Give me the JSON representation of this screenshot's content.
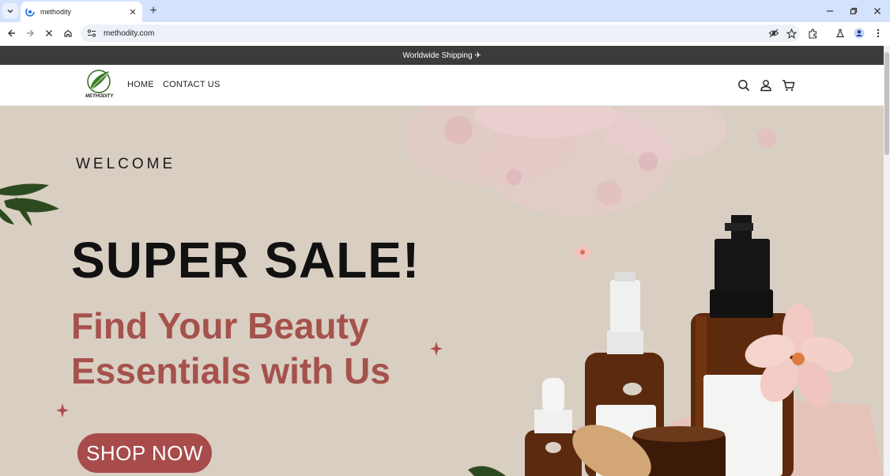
{
  "browser": {
    "tab_title": "methodity",
    "url": "methodity.com"
  },
  "site": {
    "announcement": "Worldwide Shipping ✈",
    "logo_text": "METHODITY",
    "nav": [
      {
        "label": "HOME"
      },
      {
        "label": "CONTACT US"
      }
    ]
  },
  "hero": {
    "welcome": "WELCOME",
    "headline": "SUPER SALE!",
    "subline_1": "Find Your Beauty",
    "subline_2": "Essentials with Us",
    "cta": "SHOP NOW"
  },
  "colors": {
    "hero_bg": "#d9cec2",
    "accent_red": "#a5524c",
    "button": "#a84b4b",
    "announce_bg": "#3b3b3b",
    "tabstrip": "#d3e3fd"
  }
}
